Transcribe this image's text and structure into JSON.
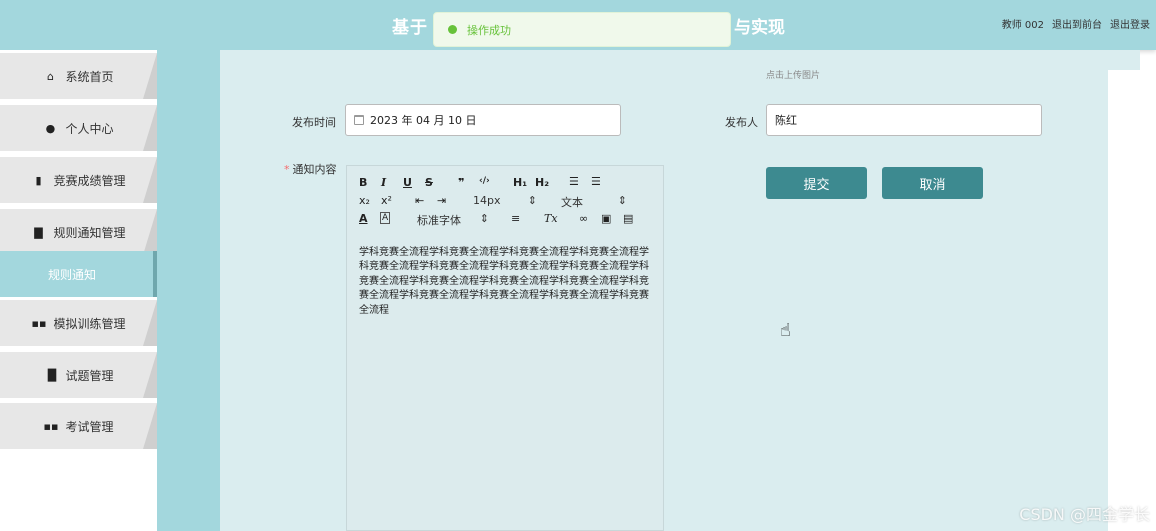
{
  "header": {
    "title_start": "基于",
    "title_end": "与实现",
    "user_role": "教师 002",
    "exit_front": "退出到前台",
    "logout": "退出登录"
  },
  "toast": {
    "message": "操作成功"
  },
  "sidebar": {
    "items": [
      {
        "label": "系统首页",
        "icon": "home-icon"
      },
      {
        "label": "个人中心",
        "icon": "user-icon"
      },
      {
        "label": "竞赛成绩管理",
        "icon": "clipboard-icon"
      },
      {
        "label": "规则通知管理",
        "icon": "book-icon"
      },
      {
        "label": "规则通知",
        "icon": "",
        "active": true
      },
      {
        "label": "模拟训练管理",
        "icon": "grid-icon"
      },
      {
        "label": "试题管理",
        "icon": "bar-chart-icon"
      },
      {
        "label": "考试管理",
        "icon": "grid-icon"
      }
    ]
  },
  "form": {
    "upload_hint": "点击上传图片",
    "publish_time_label": "发布时间",
    "publish_time_value": "2023 年 04 月 10 日",
    "publisher_label": "发布人",
    "publisher_value": "陈红",
    "content_label": "通知内容",
    "content_text": "学科竞赛全流程学科竞赛全流程学科竞赛全流程学科竞赛全流程学科竞赛全流程学科竞赛全流程学科竞赛全流程学科竞赛全流程学科竞赛全流程学科竞赛全流程学科竞赛全流程学科竞赛全流程学科竞赛全流程学科竞赛全流程学科竞赛全流程学科竞赛全流程学科竞赛全流程",
    "submit_label": "提交",
    "cancel_label": "取消"
  },
  "editor_toolbar": {
    "bold": "B",
    "italic": "I",
    "underline": "U",
    "strike": "S",
    "quote": "❞",
    "code": "‹/›",
    "h1": "H₁",
    "h2": "H₂",
    "sub": "x₂",
    "sup": "x²",
    "font_size": "14px",
    "header_select": "文本",
    "font_family": "标准字体",
    "clean": "Tx"
  },
  "watermark": "CSDN @四金学长",
  "colors": {
    "header_bg": "#a3d7dd",
    "main_bg": "#daedef",
    "button_bg": "#3d8a90",
    "toast_success": "#67c23a"
  }
}
